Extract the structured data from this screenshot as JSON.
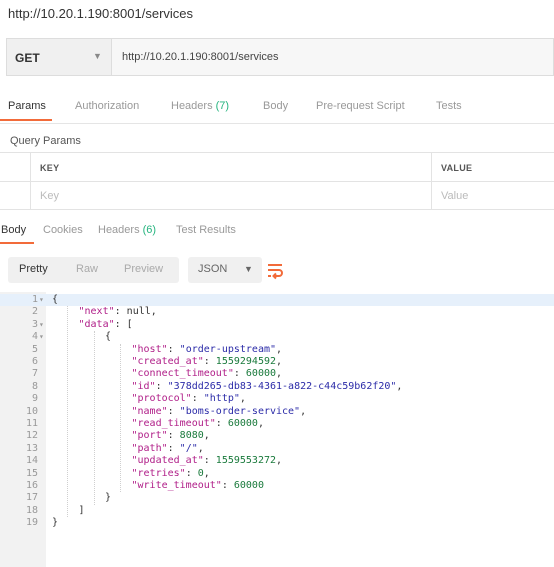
{
  "window": {
    "title": "http://10.20.1.190:8001/services"
  },
  "request": {
    "method": "GET",
    "url": "http://10.20.1.190:8001/services"
  },
  "request_tabs": [
    {
      "label": "Params",
      "count": ""
    },
    {
      "label": "Authorization",
      "count": ""
    },
    {
      "label": "Headers",
      "count": "(7)"
    },
    {
      "label": "Body",
      "count": ""
    },
    {
      "label": "Pre-request Script",
      "count": ""
    },
    {
      "label": "Tests",
      "count": ""
    }
  ],
  "query_params": {
    "title": "Query Params",
    "headers": {
      "key": "KEY",
      "value": "VALUE"
    },
    "placeholder": {
      "key": "Key",
      "value": "Value"
    }
  },
  "response_tabs": [
    {
      "label": "Body",
      "count": ""
    },
    {
      "label": "Cookies",
      "count": ""
    },
    {
      "label": "Headers",
      "count": "(6)"
    },
    {
      "label": "Test Results",
      "count": ""
    }
  ],
  "view_modes": [
    "Pretty",
    "Raw",
    "Preview"
  ],
  "format": "JSON",
  "accent_color": "#f26b3a",
  "count_color": "#26b47f",
  "response_body": [
    {
      "ln": "1",
      "fold": true,
      "indent": 0,
      "parts": [
        [
          "p",
          "{"
        ]
      ]
    },
    {
      "ln": "2",
      "fold": false,
      "indent": 1,
      "parts": [
        [
          "key",
          "\"next\""
        ],
        [
          "p",
          ": "
        ],
        [
          "p",
          "null"
        ],
        [
          "p",
          ","
        ]
      ]
    },
    {
      "ln": "3",
      "fold": true,
      "indent": 1,
      "parts": [
        [
          "key",
          "\"data\""
        ],
        [
          "p",
          ": ["
        ]
      ]
    },
    {
      "ln": "4",
      "fold": true,
      "indent": 2,
      "parts": [
        [
          "p",
          "{"
        ]
      ]
    },
    {
      "ln": "5",
      "fold": false,
      "indent": 3,
      "parts": [
        [
          "key",
          "\"host\""
        ],
        [
          "p",
          ": "
        ],
        [
          "str",
          "\"order-upstream\""
        ],
        [
          "p",
          ","
        ]
      ]
    },
    {
      "ln": "6",
      "fold": false,
      "indent": 3,
      "parts": [
        [
          "key",
          "\"created_at\""
        ],
        [
          "p",
          ": "
        ],
        [
          "num",
          "1559294592"
        ],
        [
          "p",
          ","
        ]
      ]
    },
    {
      "ln": "7",
      "fold": false,
      "indent": 3,
      "parts": [
        [
          "key",
          "\"connect_timeout\""
        ],
        [
          "p",
          ": "
        ],
        [
          "num",
          "60000"
        ],
        [
          "p",
          ","
        ]
      ]
    },
    {
      "ln": "8",
      "fold": false,
      "indent": 3,
      "parts": [
        [
          "key",
          "\"id\""
        ],
        [
          "p",
          ": "
        ],
        [
          "str",
          "\"378dd265-db83-4361-a822-c44c59b62f20\""
        ],
        [
          "p",
          ","
        ]
      ]
    },
    {
      "ln": "9",
      "fold": false,
      "indent": 3,
      "parts": [
        [
          "key",
          "\"protocol\""
        ],
        [
          "p",
          ": "
        ],
        [
          "str",
          "\"http\""
        ],
        [
          "p",
          ","
        ]
      ]
    },
    {
      "ln": "10",
      "fold": false,
      "indent": 3,
      "parts": [
        [
          "key",
          "\"name\""
        ],
        [
          "p",
          ": "
        ],
        [
          "str",
          "\"boms-order-service\""
        ],
        [
          "p",
          ","
        ]
      ]
    },
    {
      "ln": "11",
      "fold": false,
      "indent": 3,
      "parts": [
        [
          "key",
          "\"read_timeout\""
        ],
        [
          "p",
          ": "
        ],
        [
          "num",
          "60000"
        ],
        [
          "p",
          ","
        ]
      ]
    },
    {
      "ln": "12",
      "fold": false,
      "indent": 3,
      "parts": [
        [
          "key",
          "\"port\""
        ],
        [
          "p",
          ": "
        ],
        [
          "num",
          "8080"
        ],
        [
          "p",
          ","
        ]
      ]
    },
    {
      "ln": "13",
      "fold": false,
      "indent": 3,
      "parts": [
        [
          "key",
          "\"path\""
        ],
        [
          "p",
          ": "
        ],
        [
          "str",
          "\"/\""
        ],
        [
          "p",
          ","
        ]
      ]
    },
    {
      "ln": "14",
      "fold": false,
      "indent": 3,
      "parts": [
        [
          "key",
          "\"updated_at\""
        ],
        [
          "p",
          ": "
        ],
        [
          "num",
          "1559553272"
        ],
        [
          "p",
          ","
        ]
      ]
    },
    {
      "ln": "15",
      "fold": false,
      "indent": 3,
      "parts": [
        [
          "key",
          "\"retries\""
        ],
        [
          "p",
          ": "
        ],
        [
          "num",
          "0"
        ],
        [
          "p",
          ","
        ]
      ]
    },
    {
      "ln": "16",
      "fold": false,
      "indent": 3,
      "parts": [
        [
          "key",
          "\"write_timeout\""
        ],
        [
          "p",
          ": "
        ],
        [
          "num",
          "60000"
        ]
      ]
    },
    {
      "ln": "17",
      "fold": false,
      "indent": 2,
      "parts": [
        [
          "p",
          "}"
        ]
      ]
    },
    {
      "ln": "18",
      "fold": false,
      "indent": 1,
      "parts": [
        [
          "p",
          "]"
        ]
      ]
    },
    {
      "ln": "19",
      "fold": false,
      "indent": 0,
      "parts": [
        [
          "p",
          "}"
        ]
      ]
    }
  ]
}
